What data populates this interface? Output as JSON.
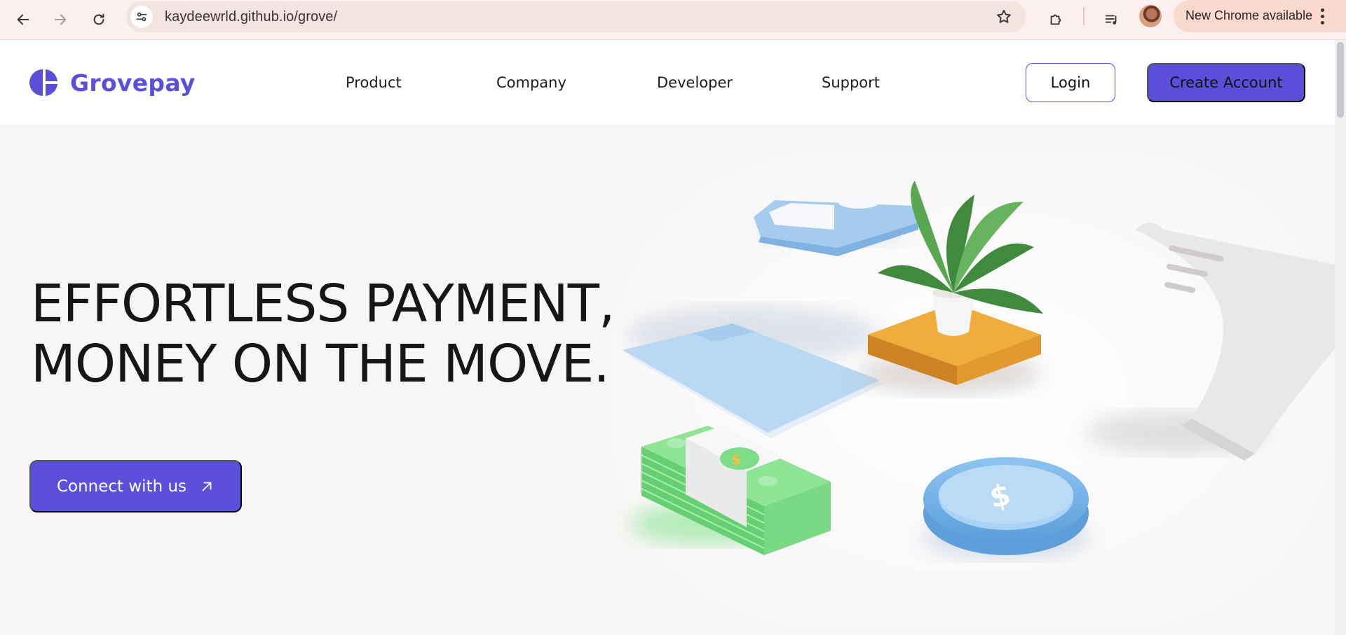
{
  "browser": {
    "url": "kaydeewrld.github.io/grove/",
    "update_label": "New Chrome available"
  },
  "site": {
    "brand": "Grovepay",
    "brand_color": "#5b4fd9",
    "nav": [
      "Product",
      "Company",
      "Developer",
      "Support"
    ],
    "login_label": "Login",
    "create_account_label": "Create Account"
  },
  "hero": {
    "title_line1": "EFFORTLESS PAYMENT,",
    "title_line2": "MONEY ON THE MOVE.",
    "cta_label": "Connect with us",
    "cta_icon": "arrow-up-right-icon"
  }
}
